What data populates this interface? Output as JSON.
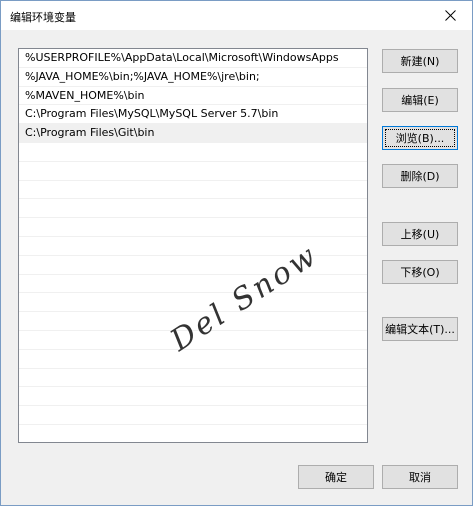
{
  "window": {
    "title": "编辑环境变量"
  },
  "list": {
    "items": [
      {
        "text": "%USERPROFILE%\\AppData\\Local\\Microsoft\\WindowsApps",
        "selected": false
      },
      {
        "text": "%JAVA_HOME%\\bin;%JAVA_HOME%\\jre\\bin;",
        "selected": false
      },
      {
        "text": "%MAVEN_HOME%\\bin",
        "selected": false
      },
      {
        "text": "C:\\Program Files\\MySQL\\MySQL Server 5.7\\bin",
        "selected": false
      },
      {
        "text": "C:\\Program Files\\Git\\bin",
        "selected": true
      }
    ]
  },
  "buttons": {
    "new": "新建(N)",
    "edit": "编辑(E)",
    "browse": "浏览(B)...",
    "delete": "删除(D)",
    "move_up": "上移(U)",
    "move_down": "下移(O)",
    "edit_text": "编辑文本(T)...",
    "ok": "确定",
    "cancel": "取消"
  },
  "watermark": {
    "text": "Del Snow"
  }
}
